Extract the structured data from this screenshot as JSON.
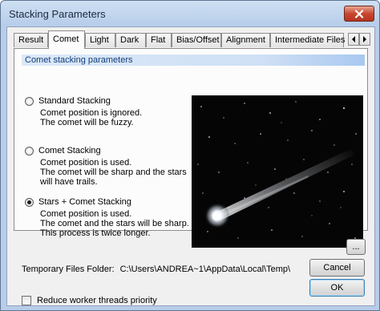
{
  "window": {
    "title": "Stacking Parameters"
  },
  "tabs": [
    {
      "label": "Result"
    },
    {
      "label": "Comet",
      "active": true
    },
    {
      "label": "Light"
    },
    {
      "label": "Dark"
    },
    {
      "label": "Flat"
    },
    {
      "label": "Bias/Offset"
    },
    {
      "label": "Alignment"
    },
    {
      "label": "Intermediate Files"
    }
  ],
  "group_header": "Comet stacking parameters",
  "options": [
    {
      "label": "Standard Stacking",
      "selected": false,
      "lines": [
        "Comet position is ignored.",
        "The comet will be fuzzy."
      ]
    },
    {
      "label": "Comet Stacking",
      "selected": false,
      "lines": [
        "Comet position is used.",
        "The comet will be sharp and the stars",
        "will have trails."
      ]
    },
    {
      "label": "Stars + Comet Stacking",
      "selected": true,
      "lines": [
        "Comet position is used.",
        "The comet and the stars will be sharp.",
        "This process is twice longer."
      ]
    }
  ],
  "temp_folder": {
    "label": "Temporary Files Folder:",
    "path": "C:\\Users\\ANDREA~1\\AppData\\Local\\Temp\\",
    "browse_label": "..."
  },
  "reduce_threads": {
    "label": "Reduce worker threads priority",
    "checked": false
  },
  "buttons": {
    "cancel": "Cancel",
    "ok": "OK"
  },
  "colors": {
    "title_bar": "#b7cde9",
    "close_button": "#c7472f",
    "group_header": "#cfe0f5",
    "default_button_border": "#3c7fb1"
  }
}
